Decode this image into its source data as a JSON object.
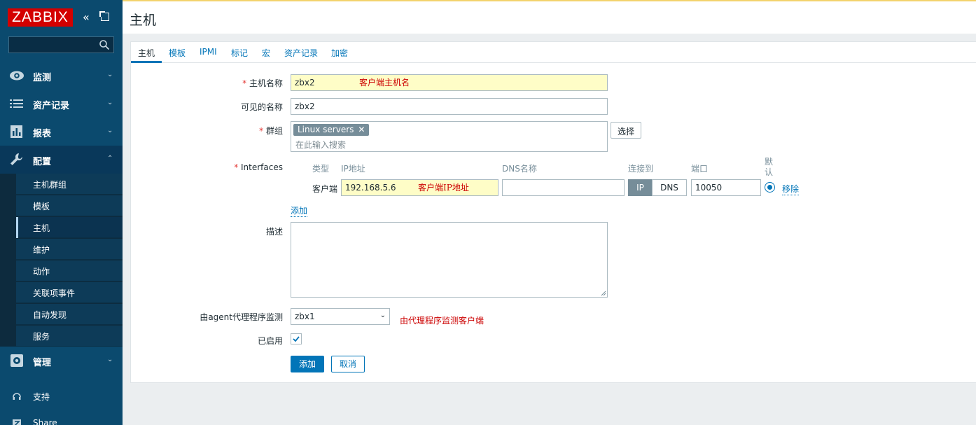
{
  "app": {
    "logo_text": "ZABBIX",
    "collapse_glyph": "«"
  },
  "sidebar": {
    "menu": [
      {
        "label": "监测",
        "icon": "eye-icon"
      },
      {
        "label": "资产记录",
        "icon": "list-icon"
      },
      {
        "label": "报表",
        "icon": "bar-chart-icon"
      },
      {
        "label": "配置",
        "icon": "wrench-icon",
        "expanded": true
      },
      {
        "label": "管理",
        "icon": "gear-icon"
      }
    ],
    "submenu": [
      {
        "label": "主机群组"
      },
      {
        "label": "模板"
      },
      {
        "label": "主机",
        "active": true
      },
      {
        "label": "维护"
      },
      {
        "label": "动作"
      },
      {
        "label": "关联项事件"
      },
      {
        "label": "自动发现"
      },
      {
        "label": "服务"
      }
    ],
    "support": "支持",
    "share": "Share"
  },
  "header": {
    "title": "主机"
  },
  "tabs": [
    "主机",
    "模板",
    "IPMI",
    "标记",
    "宏",
    "资产记录",
    "加密"
  ],
  "form": {
    "host_name": {
      "label": "主机名称",
      "value": "zbx2",
      "note": "客户端主机名"
    },
    "visible_name": {
      "label": "可见的名称",
      "value": "zbx2"
    },
    "groups": {
      "label": "群组",
      "tag": "Linux servers",
      "placeholder": "在此输入搜索",
      "select_button": "选择"
    },
    "interfaces": {
      "label": "Interfaces",
      "headers": {
        "type": "类型",
        "ip": "IP地址",
        "dns": "DNS名称",
        "connect": "连接到",
        "port": "端口",
        "default": "默认"
      },
      "row": {
        "type": "客户端",
        "ip": "192.168.5.6",
        "ip_note": "客户端IP地址",
        "dns": "",
        "connect_ip": "IP",
        "connect_dns": "DNS",
        "port": "10050",
        "remove": "移除"
      },
      "add_link": "添加"
    },
    "description": {
      "label": "描述",
      "value": ""
    },
    "proxy": {
      "label": "由agent代理程序监测",
      "value": "zbx1",
      "note": "由代理程序监测客户端"
    },
    "enabled": {
      "label": "已启用",
      "checked": true
    },
    "buttons": {
      "add": "添加",
      "cancel": "取消"
    }
  },
  "colors": {
    "sidebar_bg": "#0b4a6e",
    "accent": "#0275b8",
    "logo_red": "#d40000",
    "highlight_yellow": "#fefdc7"
  }
}
